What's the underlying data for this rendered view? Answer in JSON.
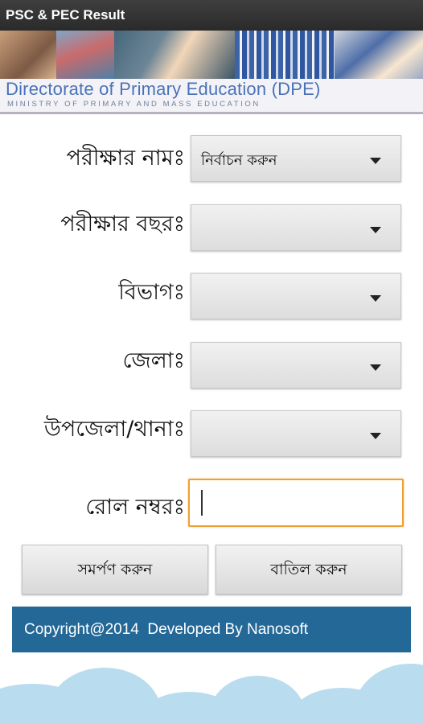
{
  "app": {
    "title": "PSC & PEC Result"
  },
  "banner": {
    "title": "Directorate of Primary Education (DPE)",
    "subtitle": "MINISTRY OF PRIMARY AND MASS EDUCATION"
  },
  "form": {
    "exam_name": {
      "label": "পরীক্ষার নামঃ",
      "value": "নির্বাচন করুন"
    },
    "exam_year": {
      "label": "পরীক্ষার বছরঃ",
      "value": ""
    },
    "division": {
      "label": "বিভাগঃ",
      "value": ""
    },
    "district": {
      "label": "জেলাঃ",
      "value": ""
    },
    "upazila": {
      "label": "উপজেলা/থানাঃ",
      "value": ""
    },
    "roll": {
      "label": "রোল নম্বরঃ",
      "value": ""
    }
  },
  "buttons": {
    "submit": "সমর্পণ করুন",
    "cancel": "বাতিল করুন"
  },
  "footer": {
    "copyright": "Copyright@2014  Developed By Nanosoft"
  },
  "colors": {
    "footer_bg": "#246898",
    "focus_border": "#f0a030",
    "titlebar_bg": "#2f2f2f"
  },
  "icons": {
    "dropdown": "caret-down-icon"
  }
}
